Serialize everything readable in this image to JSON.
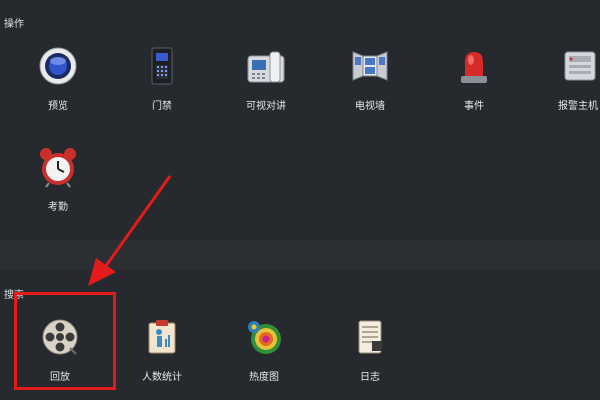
{
  "sections": {
    "operations": {
      "title": "操作",
      "items": [
        {
          "label": "预览",
          "icon": "preview-icon"
        },
        {
          "label": "门禁",
          "icon": "access-control-icon"
        },
        {
          "label": "可视对讲",
          "icon": "video-intercom-icon"
        },
        {
          "label": "电视墙",
          "icon": "video-wall-icon"
        },
        {
          "label": "事件",
          "icon": "event-alarm-icon"
        },
        {
          "label": "报警主机",
          "icon": "alarm-host-icon"
        },
        {
          "label": "考勤",
          "icon": "attendance-clock-icon"
        }
      ]
    },
    "search": {
      "title": "搜索",
      "items": [
        {
          "label": "回放",
          "icon": "playback-film-reel-icon"
        },
        {
          "label": "人数统计",
          "icon": "people-counting-icon"
        },
        {
          "label": "热度图",
          "icon": "heat-map-icon"
        },
        {
          "label": "日志",
          "icon": "log-icon"
        }
      ]
    }
  },
  "annotation": {
    "highlight_color": "#e31b1b",
    "highlighted_item": "回放"
  }
}
